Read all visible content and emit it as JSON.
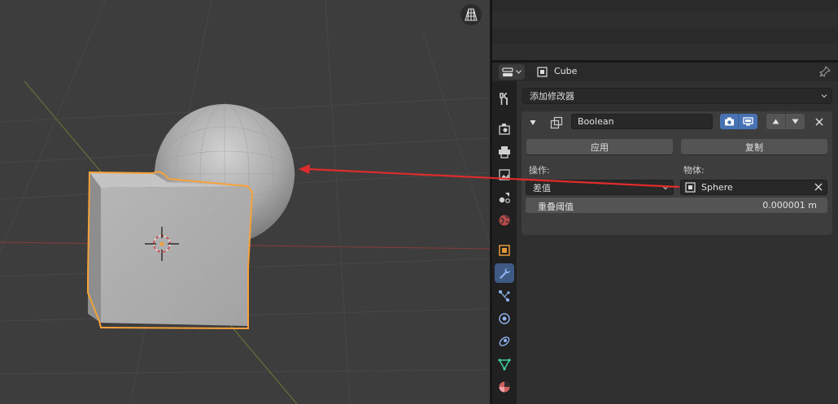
{
  "header": {
    "object_name": "Cube"
  },
  "tabs": [
    {
      "name": "tool"
    },
    {
      "name": "render"
    },
    {
      "name": "output"
    },
    {
      "name": "view-layer"
    },
    {
      "name": "scene"
    },
    {
      "name": "world"
    },
    {
      "name": "object"
    },
    {
      "name": "modifiers",
      "active": true
    },
    {
      "name": "particles"
    },
    {
      "name": "physics"
    },
    {
      "name": "constraints"
    },
    {
      "name": "data"
    },
    {
      "name": "material"
    }
  ],
  "add_modifier": {
    "label": "添加修改器"
  },
  "modifier": {
    "name": "Boolean",
    "apply_label": "应用",
    "copy_label": "复制",
    "operation_label": "操作:",
    "operation_value": "差值",
    "object_label": "物体:",
    "object_value": "Sphere",
    "overlap_label": "重叠阈值",
    "overlap_value": "0.000001 m"
  },
  "colors": {
    "accent": "#4772b3",
    "selection_outline": "#f5a23a",
    "annotation_arrow": "#e02b2b"
  }
}
